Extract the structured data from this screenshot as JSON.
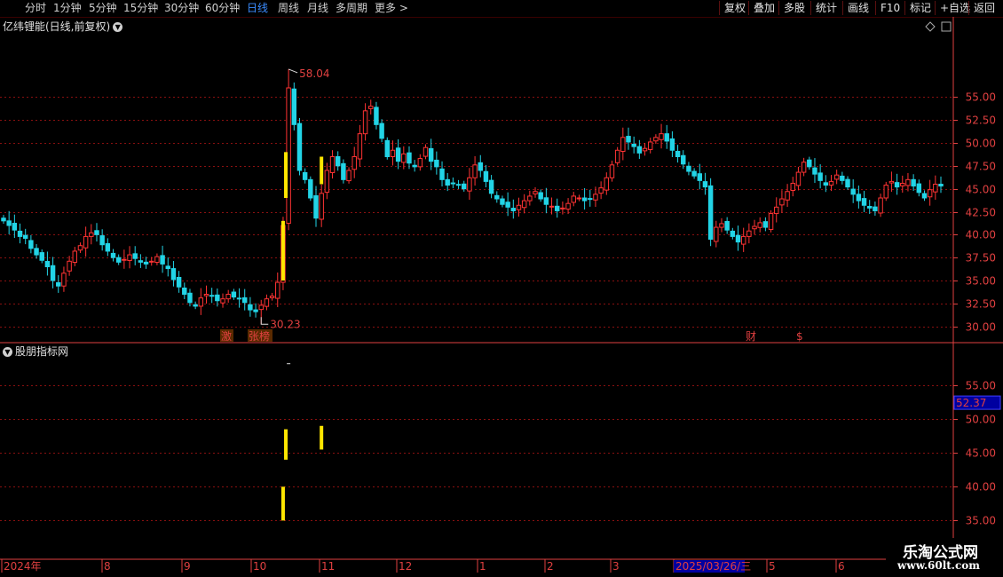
{
  "toolbar": {
    "periods": [
      "分时",
      "1分钟",
      "5分钟",
      "15分钟",
      "30分钟",
      "60分钟",
      "日线",
      "周线",
      "月线",
      "多周期",
      "更多 >"
    ],
    "active_period": "日线",
    "tools": [
      "复权",
      "叠加",
      "多股",
      "统计",
      "画线",
      "F10",
      "标记",
      "+自选",
      "返回"
    ]
  },
  "main_chart": {
    "title": "亿纬锂能(日线,前复权)",
    "high_label": "58.04",
    "low_label": "30.23",
    "markers": [
      "激",
      "张榜",
      "财",
      "$"
    ]
  },
  "indicator": {
    "title": "股朋指标网",
    "current_value": "52.37"
  },
  "watermark": {
    "line1": "乐淘公式网",
    "line2": "www.60lt.com"
  },
  "colors": {
    "up": "#ff3333",
    "down": "#22d4e6",
    "highlight": "#ffe600",
    "axis": "#e04040",
    "grid": "#8a1010"
  },
  "chart_data": {
    "type": "candlestick",
    "price_axis": {
      "ylim": [
        29.0,
        62.0
      ],
      "ticks": [
        "55.00",
        "52.50",
        "50.00",
        "47.50",
        "45.00",
        "42.50",
        "40.00",
        "37.50",
        "35.00",
        "32.50",
        "30.00"
      ]
    },
    "indicator_axis": {
      "ylim": [
        34.0,
        60.0
      ],
      "ticks": [
        "55.00",
        "50.00",
        "45.00",
        "40.00",
        "35.00"
      ]
    },
    "date_labels": [
      "2024年",
      "8",
      "9",
      "10",
      "11",
      "12",
      "1",
      "2",
      "3",
      "2025/03/26/三",
      "5",
      "6"
    ],
    "close_series": [
      41.5,
      41.0,
      40.5,
      39.8,
      39.6,
      38.5,
      37.8,
      37.2,
      36.5,
      35.0,
      34.4,
      35.8,
      37.1,
      38.2,
      38.8,
      39.8,
      40.2,
      40.0,
      38.9,
      38.2,
      37.5,
      37.0,
      37.3,
      37.8,
      37.4,
      37.0,
      36.8,
      37.1,
      37.6,
      36.8,
      36.3,
      35.1,
      34.3,
      33.5,
      32.6,
      32.2,
      33.1,
      33.5,
      33.3,
      32.8,
      33.0,
      33.5,
      33.2,
      33.0,
      32.6,
      31.8,
      31.6,
      32.3,
      33.0,
      33.3,
      34.8,
      41.0,
      56.0,
      52.0,
      47.0,
      46.0,
      44.0,
      41.8,
      44.5,
      47.0,
      48.5,
      47.5,
      46.0,
      47.0,
      48.5,
      51.0,
      53.5,
      54.0,
      52.0,
      50.5,
      48.5,
      49.2,
      48.0,
      48.8,
      47.8,
      47.4,
      48.3,
      49.5,
      48.0,
      47.4,
      46.0,
      45.4,
      45.6,
      45.4,
      45.0,
      46.2,
      47.6,
      47.0,
      45.8,
      44.5,
      43.9,
      43.3,
      43.0,
      42.6,
      43.2,
      43.7,
      44.2,
      44.7,
      43.9,
      43.3,
      43.1,
      42.6,
      42.9,
      43.4,
      44.2,
      44.0,
      43.7,
      43.9,
      44.4,
      45.1,
      46.2,
      47.6,
      49.2,
      50.6,
      50.1,
      49.6,
      48.9,
      49.4,
      50.1,
      50.6,
      51.0,
      50.2,
      49.2,
      48.5,
      47.7,
      46.9,
      46.4,
      45.9,
      45.2,
      39.5,
      40.8,
      41.2,
      40.5,
      39.8,
      39.2,
      39.8,
      40.4,
      40.9,
      41.3,
      40.8,
      42.3,
      43.0,
      43.9,
      44.7,
      45.6,
      46.8,
      47.9,
      47.4,
      46.6,
      45.9,
      45.4,
      45.8,
      46.5,
      45.9,
      45.2,
      44.4,
      43.7,
      43.2,
      42.9,
      42.6,
      44.0,
      45.4,
      45.8,
      45.2,
      45.6,
      46.0,
      45.3,
      44.6,
      44.0,
      44.9,
      45.5,
      45.3
    ]
  }
}
